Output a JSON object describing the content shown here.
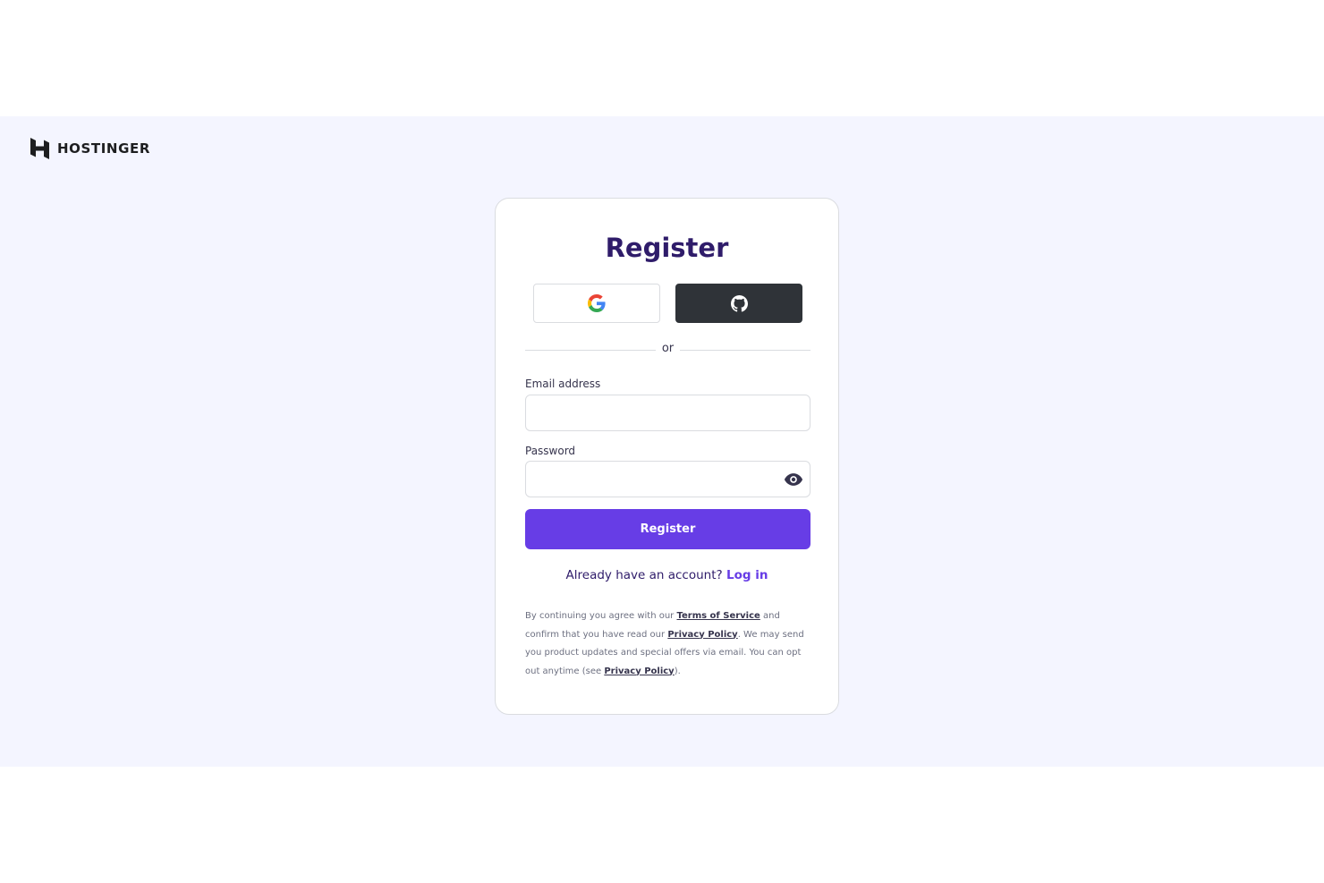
{
  "brand": {
    "name": "HOSTINGER",
    "accent": "#673de6",
    "title_color": "#2f1c6a",
    "background": "#f4f5ff"
  },
  "form": {
    "title": "Register",
    "social": {
      "google_icon": "google-icon",
      "github_icon": "github-icon"
    },
    "divider_text": "or",
    "email": {
      "label": "Email address",
      "value": "",
      "placeholder": ""
    },
    "password": {
      "label": "Password",
      "value": "",
      "placeholder": "",
      "toggle_icon": "eye-icon"
    },
    "submit_label": "Register",
    "login_prompt": {
      "text": "Already have an account?",
      "link": "Log in"
    },
    "legal": {
      "part1": "By continuing you agree with our ",
      "terms_link": "Terms of Service",
      "part2": " and confirm that you have read our ",
      "privacy_link_1": "Privacy Policy",
      "part3": ". We may send you product updates and special offers via email. You can opt out anytime (see ",
      "privacy_link_2": "Privacy Policy",
      "part4": ")."
    }
  }
}
